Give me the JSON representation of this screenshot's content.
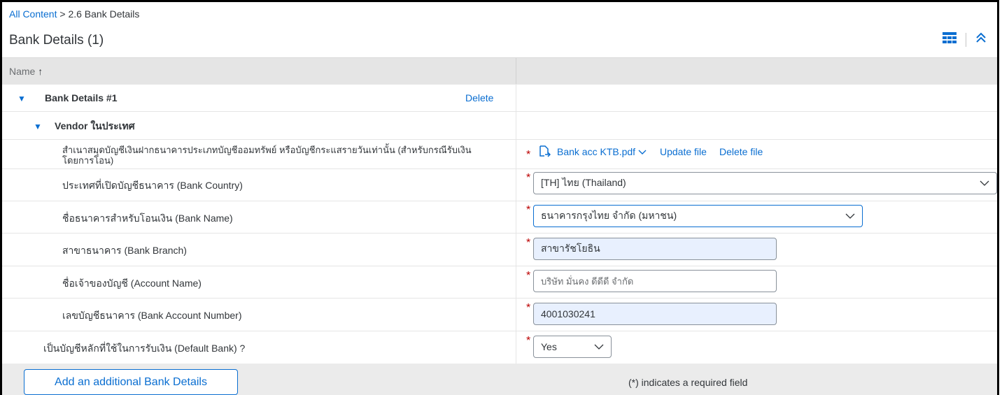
{
  "breadcrumb": {
    "root": "All Content",
    "separator": " > ",
    "current": "2.6 Bank Details"
  },
  "page_title": "Bank Details (1)",
  "toolbar": {
    "table_icon": "table-settings-icon",
    "collapse_icon": "double-chevron-up-icon"
  },
  "columns": {
    "name": "Name",
    "sort_indicator": "↑"
  },
  "group": {
    "label": "Bank Details #1",
    "delete": "Delete"
  },
  "subgroup": {
    "label": "Vendor ในประเทศ"
  },
  "fields": {
    "bank_book": {
      "label": "สำเนาสมุดบัญชีเงินฝากธนาคารประเภทบัญชีออมทรัพย์ หรือบัญชีกระแสรายวันเท่านั้น (สำหรับกรณีรับเงินโดยการโอน)",
      "file_name": "Bank acc KTB.pdf",
      "update": "Update file",
      "delete": "Delete file"
    },
    "bank_country": {
      "label": "ประเทศที่เปิดบัญชีธนาคาร (Bank Country)",
      "value": "[TH] ไทย (Thailand)"
    },
    "bank_name": {
      "label": "ชื่อธนาคารสำหรับโอนเงิน (Bank Name)",
      "value": "ธนาคารกรุงไทย จำกัด (มหาชน)"
    },
    "bank_branch": {
      "label": "สาขาธนาคาร (Bank Branch)",
      "value": "สาขารัชโยธิน"
    },
    "account_name": {
      "label": "ชื่อเจ้าของบัญชี (Account Name)",
      "value": "บริษัท มั่นคง ดีดีดี จำกัด"
    },
    "account_number": {
      "label": "เลขบัญชีธนาคาร (Bank Account Number)",
      "value": "4001030241"
    },
    "default_bank": {
      "label": "เป็นบัญชีหลักที่ใช้ในการรับเงิน (Default Bank) ?",
      "value": "Yes"
    }
  },
  "required_marker": "*",
  "footer": {
    "add_button": "Add an additional Bank Details",
    "required_note": "(*) indicates a required field"
  },
  "colors": {
    "accent": "#0a6ed1",
    "required": "#bb0000",
    "header_bg": "#e5e5e5"
  }
}
